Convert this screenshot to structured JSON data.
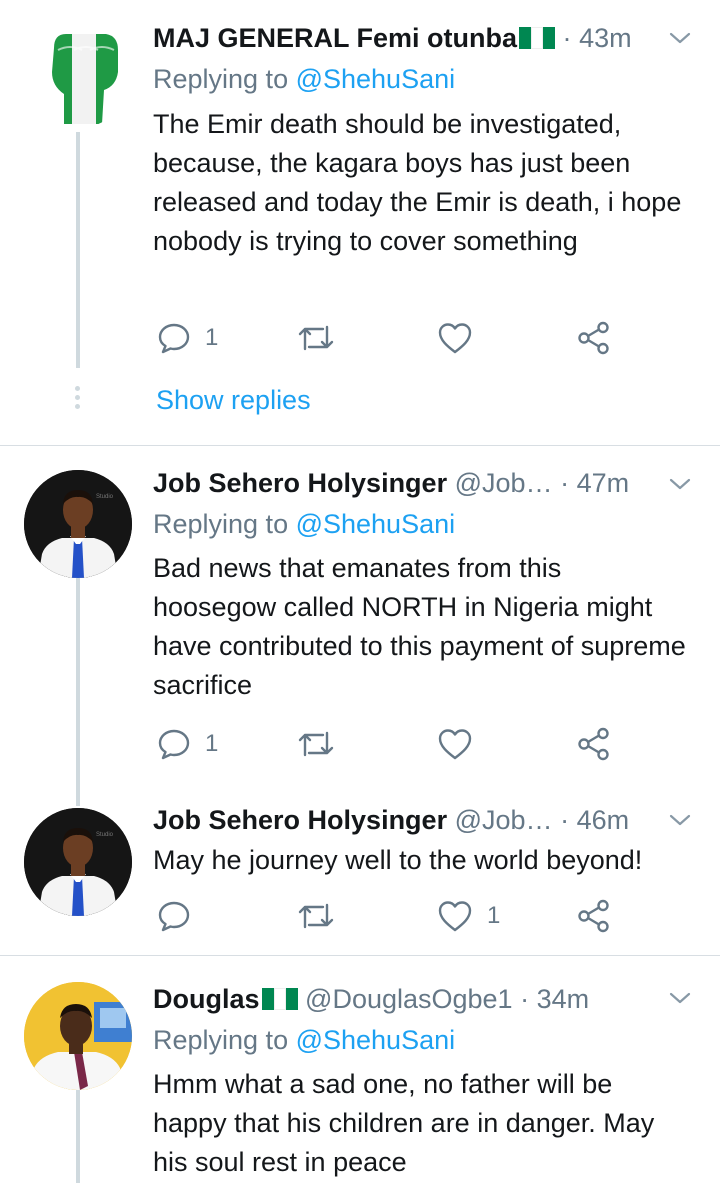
{
  "tweets": [
    {
      "name": "MAJ GENERAL Femi otunba",
      "handle": "",
      "separator": "·",
      "time": "43m",
      "replying_prefix": "Replying to ",
      "replying_to": "@ShehuSani",
      "text": "The Emir death should be investigated, because, the kagara boys has just been released and today the Emir is death, i hope nobody is trying to cover something",
      "reply_count": "1",
      "retweet_count": "",
      "like_count": "",
      "show_replies": "Show replies"
    },
    {
      "name": "Job Sehero Holysinger",
      "handle": "@Job…",
      "separator": "·",
      "time": "47m",
      "replying_prefix": "Replying to ",
      "replying_to": "@ShehuSani",
      "text": "Bad news that emanates from this hoosegow called NORTH in Nigeria might have contributed to this payment of supreme sacrifice",
      "reply_count": "1",
      "retweet_count": "",
      "like_count": ""
    },
    {
      "name": "Job Sehero Holysinger",
      "handle": "@Job…",
      "separator": "·",
      "time": "46m",
      "text": "May he journey well to the world beyond!",
      "reply_count": "",
      "retweet_count": "",
      "like_count": "1"
    },
    {
      "name": "Douglas",
      "handle": "@DouglasOgbe1",
      "separator": "·",
      "time": "34m",
      "replying_prefix": "Replying to ",
      "replying_to": "@ShehuSani",
      "text": "Hmm what a sad one, no father will be happy that his children are in danger. May his soul rest in peace"
    }
  ],
  "icons": {
    "reply": "reply-icon",
    "retweet": "retweet-icon",
    "like": "heart-icon",
    "share": "share-icon",
    "more": "chevron-down-icon",
    "flag": "nigeria-flag-icon"
  },
  "colors": {
    "text": "#14171a",
    "secondary": "#657786",
    "accent": "#1da1f2",
    "flag_green": "#008751"
  }
}
